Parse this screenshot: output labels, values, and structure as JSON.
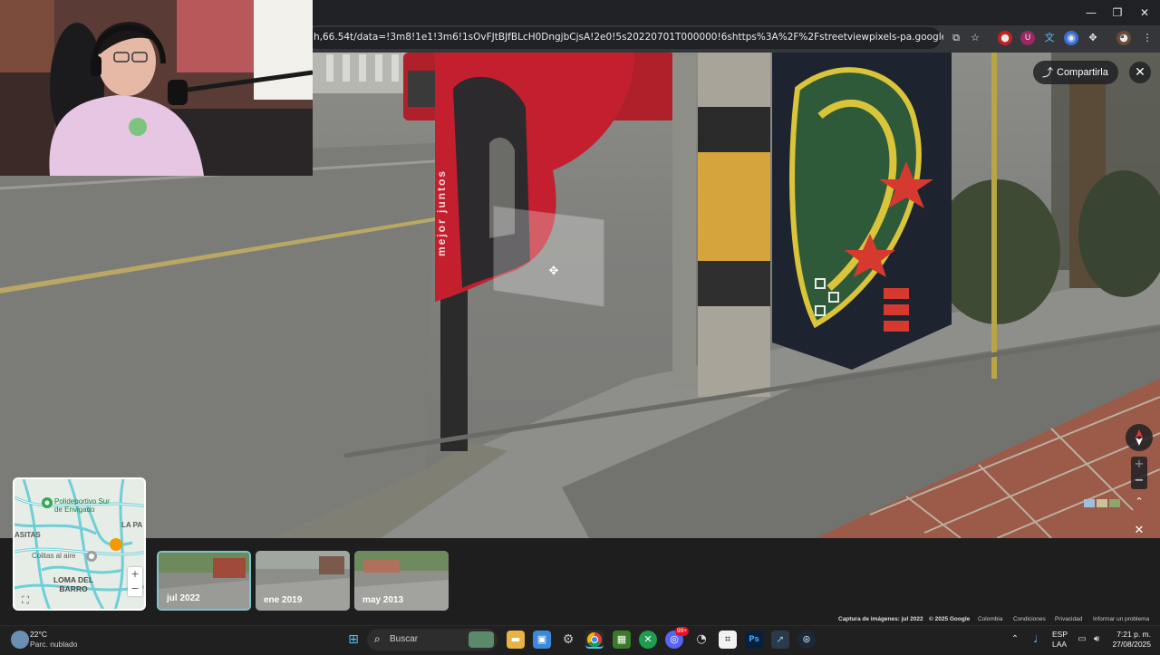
{
  "browser": {
    "url": "h,66.54t/data=!3m8!1e1!3m6!1sOvFJtBJfBLcH0DngjbCjsA!2e0!5s20220701T000000!6shttps%3A%2F%2Fstreetviewpixels-pa.googleapis.com%2Fv1%2Fthumbnail%3Fcb_clie...",
    "window_controls": {
      "minimize": "—",
      "restore": "❐",
      "close": "✕"
    }
  },
  "streetview": {
    "share_label": "Compartirla",
    "close_label": "✕",
    "booth_text": "mejor juntos",
    "zoom_in": "+",
    "zoom_out": "−",
    "close_bottom": "✕",
    "expand": "⌃"
  },
  "minimap": {
    "labels": {
      "place_name": "Polideportivo Sur de Envigado",
      "area1": "ASITAS",
      "area2": "LA PA",
      "place2": "Colitas al aire",
      "area3": "LOMA DEL BARRO",
      "road": "Carrera"
    },
    "zoom_in": "+",
    "zoom_out": "−"
  },
  "timeline": [
    {
      "label": "jul 2022"
    },
    {
      "label": "ene 2019"
    },
    {
      "label": "may 2013"
    }
  ],
  "footer": {
    "capture": "Captura de imágenes: jul 2022",
    "copyright": "© 2025 Google",
    "country": "Colombia",
    "terms": "Condiciones",
    "privacy": "Privacidad",
    "report": "Informar un problema"
  },
  "taskbar": {
    "search_label": "Buscar",
    "weather_temp": "22°C",
    "weather_desc": "Parc. nublado",
    "lang_top": "ESP",
    "lang_bottom": "LAA",
    "time": "7:21 p. m.",
    "date": "27/08/2025",
    "badge": "99+"
  },
  "colors": {
    "accent_teal": "#7ec4cf",
    "booth_red": "#c41f2e",
    "chrome_bg": "#35363a"
  }
}
